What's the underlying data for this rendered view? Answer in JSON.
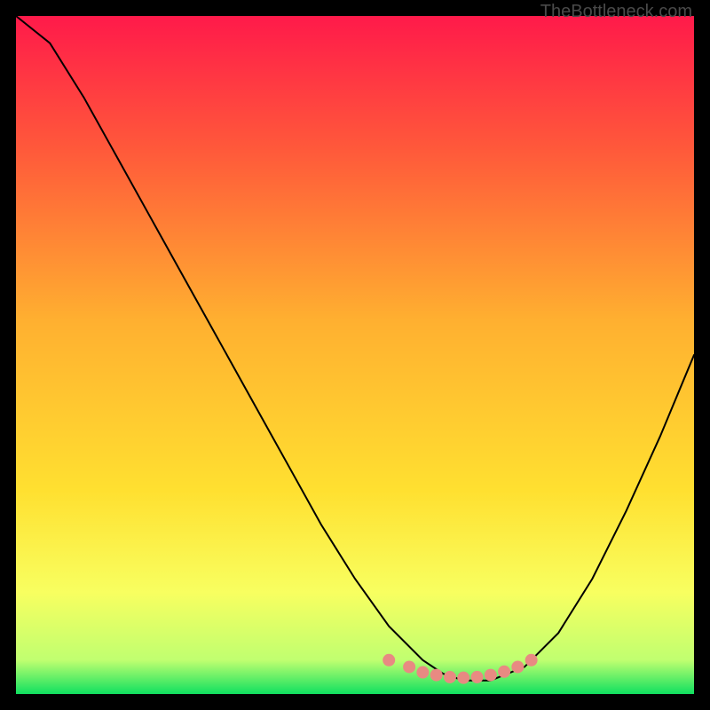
{
  "watermark": "TheBottleneck.com",
  "chart_data": {
    "type": "line",
    "title": "",
    "xlabel": "",
    "ylabel": "",
    "xlim": [
      0,
      100
    ],
    "ylim": [
      0,
      100
    ],
    "background_gradient": {
      "type": "vertical",
      "stops": [
        {
          "offset": 0,
          "color": "#ff1a4a"
        },
        {
          "offset": 20,
          "color": "#ff5a3a"
        },
        {
          "offset": 45,
          "color": "#ffb030"
        },
        {
          "offset": 70,
          "color": "#ffe030"
        },
        {
          "offset": 85,
          "color": "#f8ff60"
        },
        {
          "offset": 95,
          "color": "#c0ff70"
        },
        {
          "offset": 100,
          "color": "#10e060"
        }
      ]
    },
    "series": [
      {
        "name": "bottleneck-curve",
        "color": "#000000",
        "x": [
          0,
          5,
          10,
          15,
          20,
          25,
          30,
          35,
          40,
          45,
          50,
          55,
          60,
          63,
          66,
          70,
          75,
          80,
          85,
          90,
          95,
          100
        ],
        "values": [
          100,
          96,
          88,
          79,
          70,
          61,
          52,
          43,
          34,
          25,
          17,
          10,
          5,
          3,
          2,
          2,
          4,
          9,
          17,
          27,
          38,
          50
        ]
      },
      {
        "name": "optimal-range-marker",
        "type": "scatter",
        "color": "#e88a82",
        "marker_size": 14,
        "x": [
          55,
          58,
          60,
          62,
          64,
          66,
          68,
          70,
          72,
          74,
          76
        ],
        "values": [
          5,
          4,
          3.2,
          2.8,
          2.5,
          2.4,
          2.5,
          2.8,
          3.3,
          4,
          5
        ]
      }
    ]
  }
}
